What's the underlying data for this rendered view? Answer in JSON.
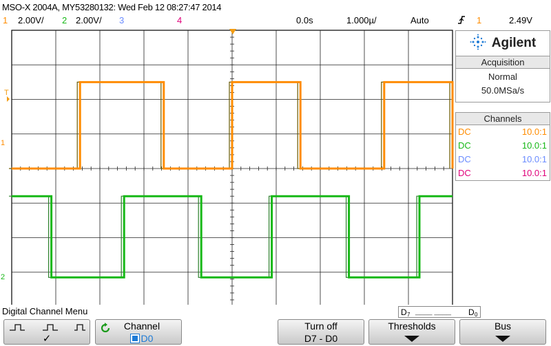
{
  "header": {
    "title": "MSO-X 2004A, MY53280132: Wed Feb 12 08:27:47 2014",
    "ch1_num": "1",
    "ch1_scale": "2.00V/",
    "ch2_num": "2",
    "ch2_scale": "2.00V/",
    "ch3_num": "3",
    "ch4_num": "4",
    "time_pos": "0.0s",
    "time_scale": "1.000µ/",
    "trig_mode": "Auto",
    "trig_icon": "rising-edge-icon",
    "trig_src": "1",
    "trig_level": "2.49V"
  },
  "colors": {
    "ch1": "#ff8c00",
    "ch2": "#17b817",
    "ch3": "#6a8cff",
    "ch4": "#e0007a",
    "grid": "#222222",
    "grid_border": "#000000",
    "trace_ch2_alt": "#2a7f2a",
    "trace_ch1_alt": "#6a5a00",
    "marker_orange": "#f39c12"
  },
  "side": {
    "brand": "Agilent",
    "acq_header": "Acquisition",
    "acq_mode": "Normal",
    "acq_rate": "50.0MSa/s",
    "ch_header": "Channels",
    "channels": [
      {
        "coupling": "DC",
        "probe": "10.0:1"
      },
      {
        "coupling": "DC",
        "probe": "10.0:1"
      },
      {
        "coupling": "DC",
        "probe": "10.0:1"
      },
      {
        "coupling": "DC",
        "probe": "10.0:1"
      }
    ]
  },
  "screen": {
    "ch1_marker": "1",
    "ch2_marker": "2",
    "trig_marker": "T"
  },
  "waveforms": {
    "time_divs": 10,
    "volt_divs": 8,
    "ch1": {
      "edges_div": [
        1.55,
        3.45,
        5.0,
        6.55,
        8.45,
        10.0
      ],
      "high_div": 2.5,
      "low_div": 0.0,
      "start_high": false
    },
    "ch2": {
      "edges_div": [
        0.9,
        2.55,
        4.3,
        5.9,
        7.65,
        9.25
      ],
      "high_div": -0.8,
      "low_div": -3.15,
      "start_high": true
    }
  },
  "footer": {
    "menu_title": "Digital Channel Menu",
    "dbox_left": "D",
    "dbox_left_sub": "7",
    "dbox_dash": "____  ____",
    "dbox_right": "D",
    "dbox_right_sub": "0",
    "softkeys": {
      "sk1_icons": "threshold-icons",
      "sk1_check": "✓",
      "sk2_label": "Channel",
      "sk2_value": "D0",
      "sk3_l1": "Turn off",
      "sk3_l2": "D7 - D0",
      "sk4_l1": "Thresholds",
      "sk5_l1": "Bus"
    }
  }
}
